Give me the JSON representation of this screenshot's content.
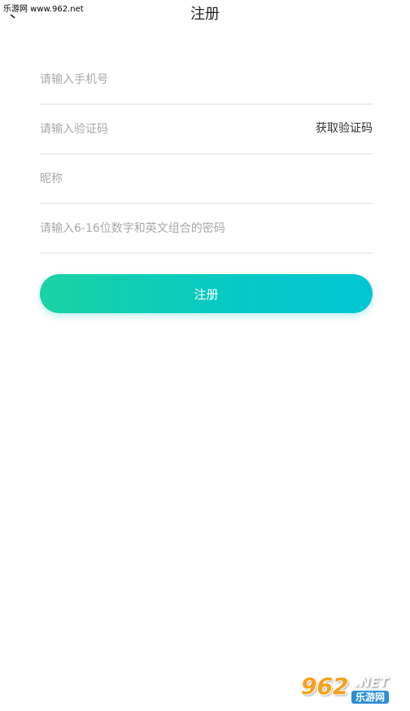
{
  "watermark": {
    "top_text": "乐游网 www.962.net",
    "logo_digits": "962",
    "logo_net": ".NET",
    "logo_cn": "乐游网"
  },
  "header": {
    "title": "注册",
    "back_icon": "back-arrow-icon"
  },
  "form": {
    "phone_placeholder": "请输入手机号",
    "code_placeholder": "请输入验证码",
    "get_code_label": "获取验证码",
    "nickname_placeholder": "昵称",
    "password_placeholder": "请输入6-16位数字和英文组合的密码",
    "submit_label": "注册"
  },
  "colors": {
    "button_gradient_start": "#1ad2a4",
    "button_gradient_end": "#02c6d4",
    "divider": "#eeeeee",
    "placeholder": "#a9a9a9"
  }
}
